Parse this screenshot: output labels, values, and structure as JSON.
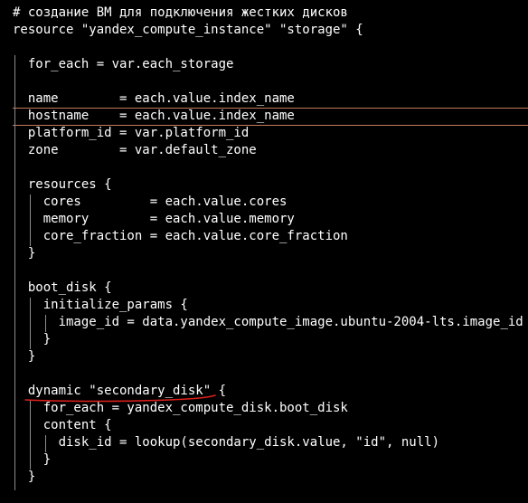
{
  "editor": {
    "language": "terraform",
    "lines": [
      "# создание ВМ для подключения жестких дисков",
      "resource \"yandex_compute_instance\" \"storage\" {",
      "",
      "  for_each = var.each_storage",
      "",
      "  name        = each.value.index_name",
      "  hostname    = each.value.index_name",
      "  platform_id = var.platform_id",
      "  zone        = var.default_zone",
      "",
      "  resources {",
      "    cores         = each.value.cores",
      "    memory        = each.value.memory",
      "    core_fraction = each.value.core_fraction",
      "  }",
      "",
      "  boot_disk {",
      "    initialize_params {",
      "      image_id = data.yandex_compute_image.ubuntu-2004-lts.image_id",
      "    }",
      "  }",
      "",
      "  dynamic \"secondary_disk\" {",
      "    for_each = yandex_compute_disk.boot_disk",
      "    content {",
      "      disk_id = lookup(secondary_disk.value, \"id\", null)",
      "    }",
      "  }"
    ]
  },
  "colors": {
    "background": "#000000",
    "text": "#ffffff",
    "indent_guide": "#8c8c8c",
    "cursor_line": "#c87a5a",
    "annotation_underline": "#e0201c"
  }
}
